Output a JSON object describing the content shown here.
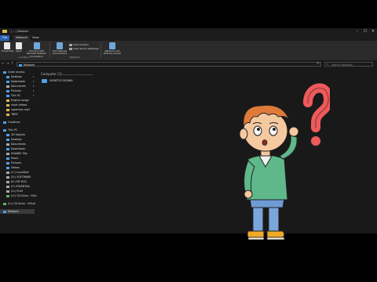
{
  "titlebar": {
    "title": "| ⌄ | Network",
    "min": "–",
    "max": "☐",
    "close": "✕"
  },
  "tabs": [
    {
      "label": "File"
    },
    {
      "label": "Network"
    },
    {
      "label": "View"
    }
  ],
  "ribbon": {
    "items": [
      {
        "label": "Properties"
      },
      {
        "label": "Open"
      },
      {
        "label": "Connect with Remote Desktop Connection"
      },
      {
        "label": "Add devices and printers"
      },
      {
        "label": "Network and Sharing Center"
      }
    ],
    "small": [
      {
        "label": "View printers"
      },
      {
        "label": "View device webpage"
      }
    ],
    "groups": [
      {
        "label": "Location"
      },
      {
        "label": "Network"
      }
    ]
  },
  "address": {
    "path": "Network",
    "search_placeholder": "Search Network"
  },
  "nav": {
    "items": [
      {
        "label": "Quick access"
      },
      {
        "label": "Desktop"
      },
      {
        "label": "Downloads"
      },
      {
        "label": "Documents"
      },
      {
        "label": "Pictures"
      },
      {
        "label": "This PC"
      },
      {
        "label": "English songs"
      },
      {
        "label": "short videos"
      },
      {
        "label": "speeches mp3"
      },
      {
        "label": "TBRE"
      },
      {
        "label": "OneDrive"
      },
      {
        "label": "This PC"
      },
      {
        "label": "3D Objects"
      },
      {
        "label": "Desktop"
      },
      {
        "label": "Documents"
      },
      {
        "label": "Downloads"
      },
      {
        "label": "HUAWEI Y9p"
      },
      {
        "label": "Music"
      },
      {
        "label": "Pictures"
      },
      {
        "label": "Videos"
      },
      {
        "label": "(C:) LocalDisk"
      },
      {
        "label": "(D:) SOFTWARE"
      },
      {
        "label": "(E:) MY DOC"
      },
      {
        "label": "(F:) ESSENTIAL"
      },
      {
        "label": "(G:) PLAY"
      },
      {
        "label": "(H:) CD Drive - HiSu"
      },
      {
        "label": "(H:) CD Drive - HiSuit"
      },
      {
        "label": "Network"
      }
    ]
  },
  "content": {
    "group": "Computer (1)",
    "computer": "DESKTOP-3SGBIH"
  },
  "colors": {
    "window_bg": "#191919",
    "ribbon_bg": "#2b2b2b",
    "accent": "#2a61b0"
  }
}
